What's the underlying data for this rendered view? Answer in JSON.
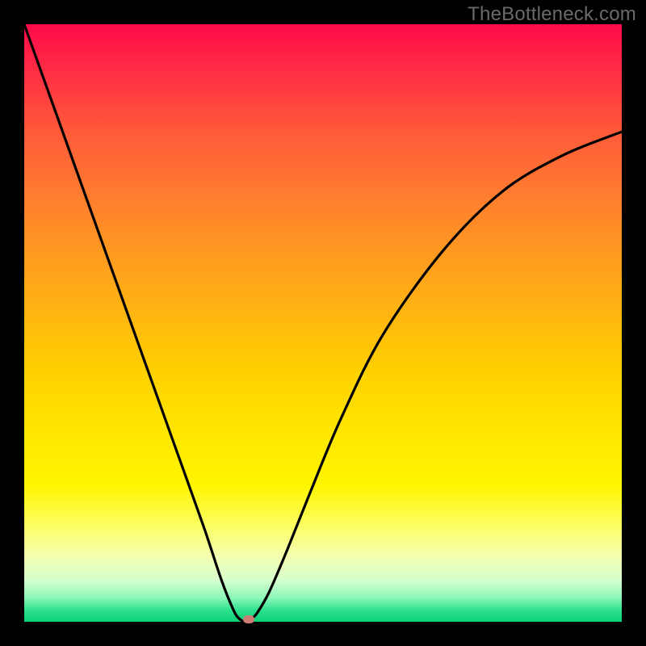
{
  "watermark": "TheBottleneck.com",
  "colors": {
    "frame": "#000000",
    "curve_stroke": "#000000",
    "marker_fill": "#cb7d74"
  },
  "chart_data": {
    "type": "line",
    "title": "",
    "xlabel": "",
    "ylabel": "",
    "xlim": [
      0,
      100
    ],
    "ylim": [
      0,
      100
    ],
    "grid": false,
    "legend": false,
    "description": "V-shaped bottleneck curve with minimum near x≈37; left branch steep, right branch asymptotically rising to the right edge at ~82% height",
    "series": [
      {
        "name": "bottleneck-curve",
        "x": [
          0,
          5,
          10,
          15,
          20,
          25,
          30,
          33,
          35,
          36,
          37,
          38,
          39,
          41,
          44,
          48,
          53,
          60,
          70,
          80,
          90,
          100
        ],
        "values": [
          100,
          86,
          72,
          58,
          44,
          30,
          16,
          7,
          2,
          0.5,
          0,
          0.5,
          1.5,
          5,
          12,
          22,
          34,
          48,
          62,
          72,
          78,
          82
        ]
      }
    ],
    "marker": {
      "x": 37.5,
      "y": 0,
      "label": "optimal-point"
    }
  }
}
